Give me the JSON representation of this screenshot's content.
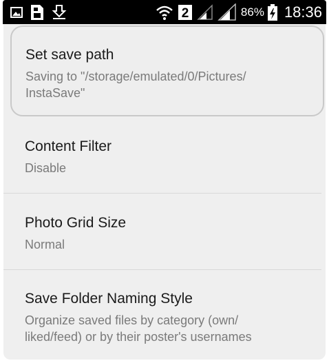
{
  "status_bar": {
    "icons_left": [
      "gallery-icon",
      "sim-card-icon",
      "download-notification-icon"
    ],
    "icons_right": [
      "wifi-icon",
      "sim-slot-icon",
      "signal-icon",
      "signal-icon",
      "battery-icon"
    ],
    "sim_number": "2",
    "battery_percent": "86%",
    "time": "18:36"
  },
  "preferences": [
    {
      "title": "Set save path",
      "summary": "Saving to \"/storage/emulated/0/Pictures/\nInstaSave\""
    },
    {
      "title": "Content Filter",
      "summary": "Disable"
    },
    {
      "title": "Photo Grid Size",
      "summary": "Normal"
    },
    {
      "title": "Save Folder Naming Style",
      "summary": "Organize saved files by category (own/\nliked/feed) or by their poster's usernames"
    }
  ]
}
